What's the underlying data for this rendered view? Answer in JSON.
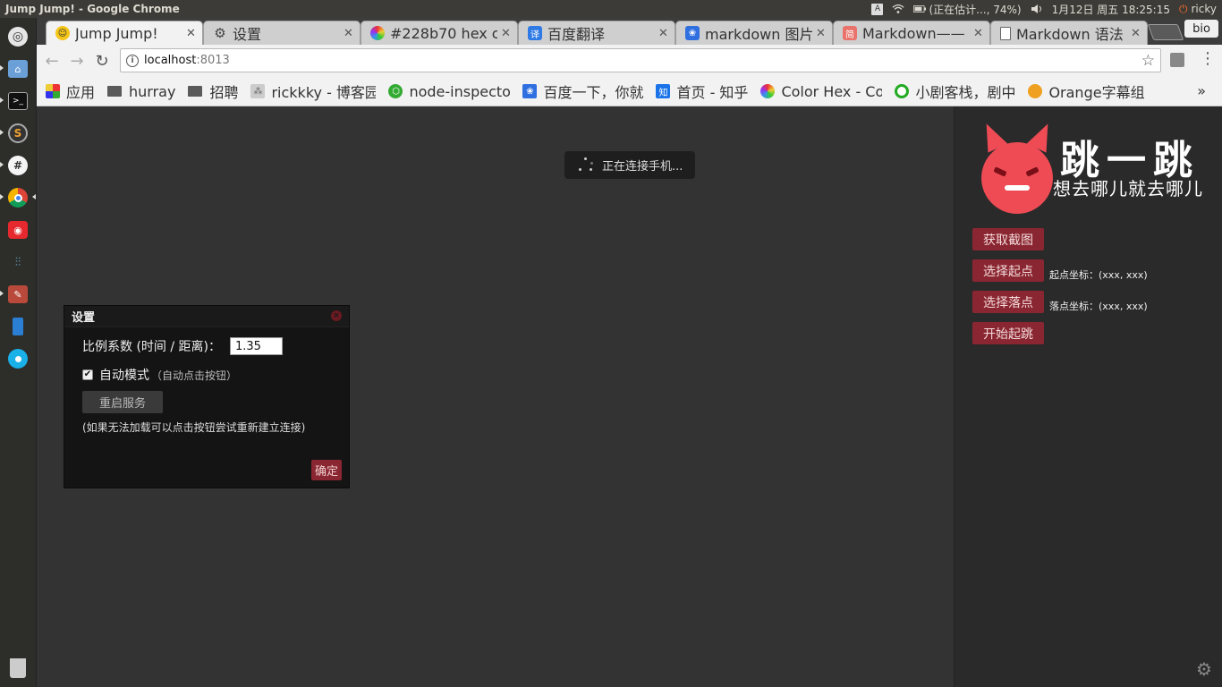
{
  "system": {
    "window_title": "Jump Jump! - Google Chrome",
    "input_method": "A",
    "battery": "(正在估计..., 74%)",
    "clock": "1月12日 周五 18:25:15",
    "user": "ricky"
  },
  "launcher": {
    "items": [
      "ubuntu-dash",
      "files",
      "terminal",
      "sublime",
      "hashtag",
      "chrome",
      "netease-music",
      "settings-tool",
      "editor",
      "phone",
      "circle-app",
      "trash"
    ]
  },
  "browser": {
    "tabs": [
      {
        "title": "Jump Jump!",
        "icon": "smiley-icon",
        "active": true
      },
      {
        "title": "设置",
        "icon": "gear-icon"
      },
      {
        "title": "#228b70 hex c",
        "icon": "colorhex-icon"
      },
      {
        "title": "百度翻译",
        "icon": "translate-icon"
      },
      {
        "title": "markdown 图片",
        "icon": "baidu-paw-icon"
      },
      {
        "title": "Markdown——",
        "icon": "jianshu-icon"
      },
      {
        "title": "Markdown 语法",
        "icon": "doc-icon"
      }
    ],
    "profile": "bio",
    "url_host": "localhost",
    "url_port": ":8013",
    "bookmarks": [
      {
        "label": "应用",
        "icon": "apps-grid-icon"
      },
      {
        "label": "hurray",
        "icon": "folder-icon"
      },
      {
        "label": "招聘",
        "icon": "folder-icon"
      },
      {
        "label": "rickkky - 博客园",
        "icon": "cnblogs-icon"
      },
      {
        "label": "node-inspecto",
        "icon": "node-icon"
      },
      {
        "label": "百度一下，你就",
        "icon": "baidu-paw-icon"
      },
      {
        "label": "首页 - 知乎",
        "icon": "zhihu-icon"
      },
      {
        "label": "Color Hex - Co",
        "icon": "colorhex-icon"
      },
      {
        "label": "小剧客栈，剧中",
        "icon": "green-ring-icon"
      },
      {
        "label": "Orange字幕组",
        "icon": "orange-icon"
      }
    ],
    "bookmarks_more": "»"
  },
  "page": {
    "toast": "正在连接手机...",
    "dialog": {
      "title": "设置",
      "ratio_label": "比例系数 (时间 / 距离)：",
      "ratio_value": "1.35",
      "auto_label": "自动模式",
      "auto_hint": "（自动点击按钮）",
      "auto_checked": true,
      "restart_label": "重启服务",
      "restart_note": "(如果无法加载可以点击按钮尝试重新建立连接)",
      "ok_label": "确定"
    },
    "logo": {
      "title": "跳一跳",
      "subtitle": "想去哪儿就去哪儿"
    },
    "side": {
      "screenshot_btn": "获取截图",
      "start_btn": "选择起点",
      "start_coord": "起点坐标：(xxx, xxx)",
      "end_btn": "选择落点",
      "end_coord": "落点坐标：(xxx, xxx)",
      "jump_btn": "开始起跳"
    }
  },
  "colors": {
    "accent": "#8a2631",
    "devil": "#ee4b55",
    "panel": "#2a2a2a",
    "main": "#333333"
  }
}
